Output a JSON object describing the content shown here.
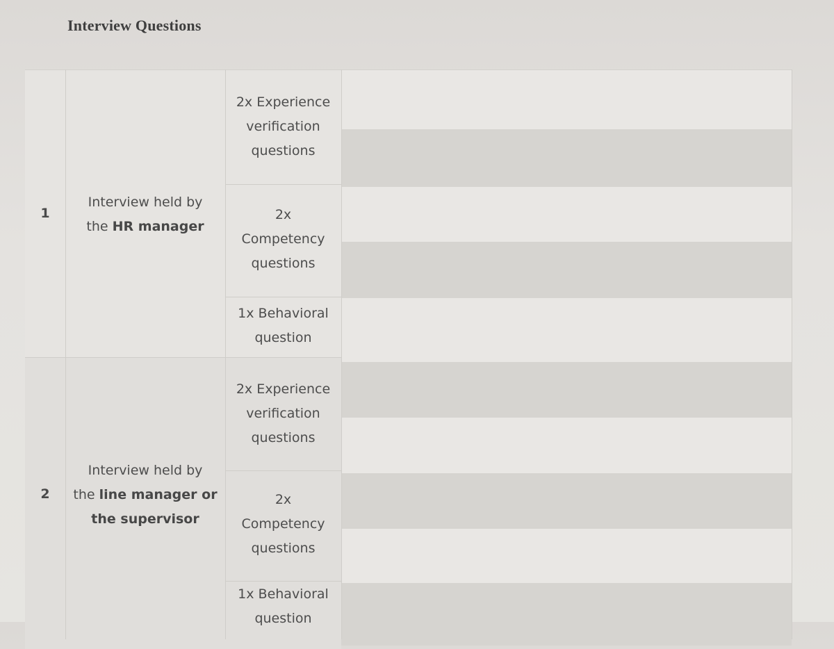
{
  "title": "Interview Questions",
  "rows": [
    {
      "number": "1",
      "interviewer": {
        "prefix": "Interview held by",
        "line2_plain": "the ",
        "line2_bold": "HR manager",
        "line3_bold": ""
      },
      "questions": [
        {
          "count": "2x",
          "lines": [
            "2x Experience",
            "verification",
            "questions"
          ]
        },
        {
          "count": "2x",
          "lines": [
            "2x",
            "Competency",
            "questions"
          ]
        },
        {
          "count": "1x",
          "lines": [
            "1x Behavioral",
            "question"
          ]
        }
      ]
    },
    {
      "number": "2",
      "interviewer": {
        "prefix": "Interview held by",
        "line2_plain": "the ",
        "line2_bold": "line manager or",
        "line3_bold": "the supervisor"
      },
      "questions": [
        {
          "count": "2x",
          "lines": [
            "2x Experience",
            "verification",
            "questions"
          ]
        },
        {
          "count": "2x",
          "lines": [
            "2x",
            "Competency",
            "questions"
          ]
        },
        {
          "count": "1x",
          "lines": [
            "1x Behavioral",
            "question"
          ]
        }
      ]
    }
  ],
  "answer_column": {
    "content": ""
  }
}
